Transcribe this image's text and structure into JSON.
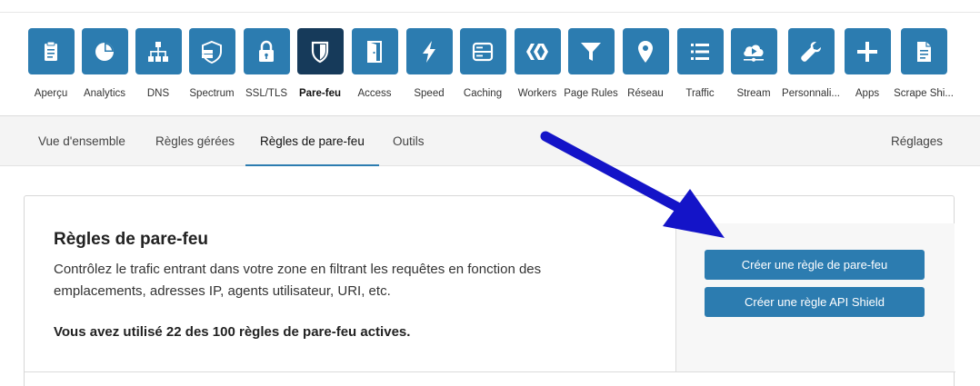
{
  "apps": [
    {
      "label": "Aperçu",
      "icon": "clipboard-icon"
    },
    {
      "label": "Analytics",
      "icon": "pie-chart-icon"
    },
    {
      "label": "DNS",
      "icon": "network-icon"
    },
    {
      "label": "Spectrum",
      "icon": "shield-server-icon"
    },
    {
      "label": "SSL/TLS",
      "icon": "lock-icon"
    },
    {
      "label": "Pare-feu",
      "icon": "shield-icon",
      "active": true
    },
    {
      "label": "Access",
      "icon": "door-icon"
    },
    {
      "label": "Speed",
      "icon": "lightning-icon"
    },
    {
      "label": "Caching",
      "icon": "server-icon"
    },
    {
      "label": "Workers",
      "icon": "workers-icon"
    },
    {
      "label": "Page Rules",
      "icon": "filter-icon"
    },
    {
      "label": "Réseau",
      "icon": "location-pin-icon"
    },
    {
      "label": "Traffic",
      "icon": "list-icon"
    },
    {
      "label": "Stream",
      "icon": "cloud-play-icon"
    },
    {
      "label": "Personnali...",
      "icon": "wrench-icon"
    },
    {
      "label": "Apps",
      "icon": "plus-icon"
    },
    {
      "label": "Scrape Shi...",
      "icon": "document-icon"
    }
  ],
  "subnav": {
    "tabs": [
      "Vue d'ensemble",
      "Règles gérées",
      "Règles de pare-feu",
      "Outils"
    ],
    "active_tab": "Règles de pare-feu",
    "settings": "Réglages"
  },
  "card": {
    "title": "Règles de pare-feu",
    "description": "Contrôlez le trafic entrant dans votre zone en filtrant les requêtes en fonction des emplacements, adresses IP, agents utilisateur, URI, etc.",
    "usage": "Vous avez utilisé 22 des 100 règles de pare-feu actives.",
    "create_rule_button": "Créer une règle de pare-feu",
    "create_api_shield_button": "Créer une règle API Shield"
  },
  "colors": {
    "tile": "#2c7cb0",
    "tile_active": "#163a5a",
    "button": "#2c7cb0",
    "arrow": "#1414c8"
  }
}
